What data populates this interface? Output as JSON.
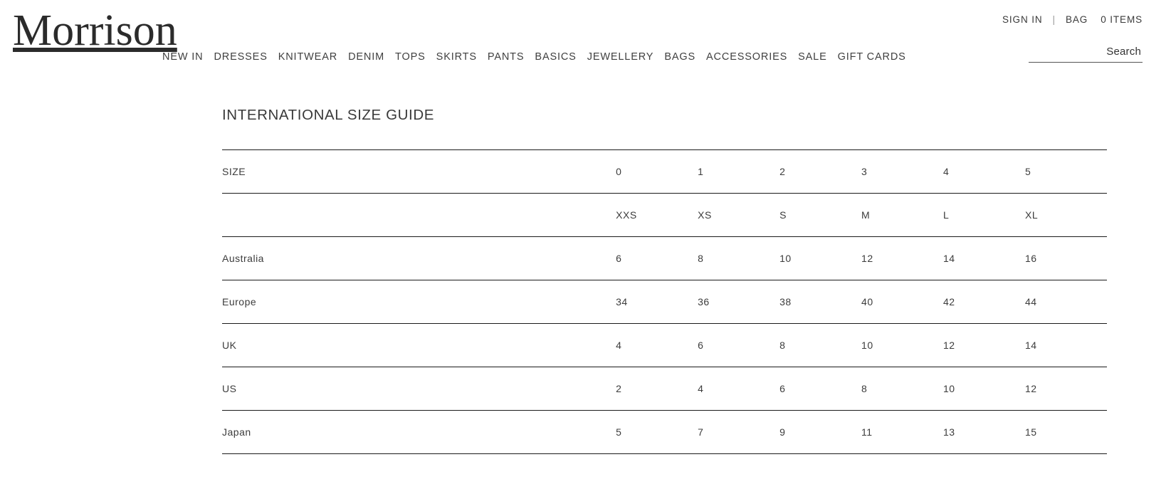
{
  "header": {
    "logo": "Morrison",
    "utility": {
      "sign_in": "SIGN IN",
      "separator": "|",
      "bag": "BAG",
      "items_count": "0 ITEMS"
    },
    "search": {
      "placeholder": "Search",
      "value": ""
    },
    "nav_items": [
      {
        "label": "NEW IN"
      },
      {
        "label": "DRESSES"
      },
      {
        "label": "KNITWEAR"
      },
      {
        "label": "DENIM"
      },
      {
        "label": "TOPS"
      },
      {
        "label": "SKIRTS"
      },
      {
        "label": "PANTS"
      },
      {
        "label": "BASICS"
      },
      {
        "label": "JEWELLERY"
      },
      {
        "label": "BAGS"
      },
      {
        "label": "ACCESSORIES"
      },
      {
        "label": "SALE"
      },
      {
        "label": "GIFT CARDS"
      }
    ]
  },
  "main": {
    "page_title": "INTERNATIONAL SIZE GUIDE",
    "table": {
      "size_header_label": "SIZE",
      "size_numbers": [
        "0",
        "1",
        "2",
        "3",
        "4",
        "5"
      ],
      "size_letters": [
        "XXS",
        "XS",
        "S",
        "M",
        "L",
        "XL"
      ],
      "letters_row_label": "",
      "rows": [
        {
          "region": "Australia",
          "values": [
            "6",
            "8",
            "10",
            "12",
            "14",
            "16"
          ]
        },
        {
          "region": "Europe",
          "values": [
            "34",
            "36",
            "38",
            "40",
            "42",
            "44"
          ]
        },
        {
          "region": "UK",
          "values": [
            "4",
            "6",
            "8",
            "10",
            "12",
            "14"
          ]
        },
        {
          "region": "US",
          "values": [
            "2",
            "4",
            "6",
            "8",
            "10",
            "12"
          ]
        },
        {
          "region": "Japan",
          "values": [
            "5",
            "7",
            "9",
            "11",
            "13",
            "15"
          ]
        }
      ]
    }
  },
  "colors": {
    "text": "#3c3c3c",
    "rule": "#1a1a1a",
    "background": "#ffffff"
  }
}
